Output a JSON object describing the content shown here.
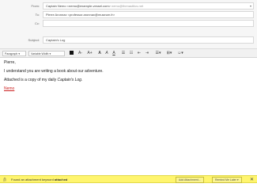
{
  "header": {
    "from_label": "From:",
    "from_value": "Captain Nemo <nemo@example-vessel.com>",
    "from_hint": "  nemo@thenautilus.net",
    "to_label": "To:",
    "to_value": "Pierre Aronnax <professor.aronnax@museum.fr>",
    "cc_label": "Cc:",
    "cc_value": "",
    "subject_label": "Subject:",
    "subject_value": "Captain's Log"
  },
  "toolbar": {
    "paragraph_format": "Paragraph",
    "font_family": "Variable Width",
    "text_color_icon": "color-swatch-icon",
    "buttons": [
      "A-",
      "A+",
      "A",
      "A",
      "A",
      "list",
      "numbered-list",
      "outdent",
      "indent",
      "align",
      "insert"
    ]
  },
  "body": {
    "greeting": "Pierre,",
    "line1": "I understand you are writing a book about our adventure.",
    "line2_prefix": "Attached is a copy of my daily ",
    "line2_italic": "Captain's Log",
    "line2_suffix": ".",
    "signature": "Nemo"
  },
  "notification": {
    "text_prefix": "Found an attachment keyword ",
    "keyword": "attached",
    "add_attachment_label": "Add Attachment...",
    "remind_label": "Remind Me Later",
    "close_icon": "close-icon"
  }
}
